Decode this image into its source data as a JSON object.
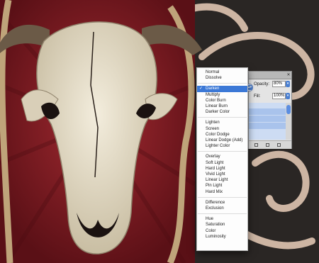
{
  "blend_menu": {
    "groups": [
      [
        "Normal",
        "Dissolve"
      ],
      [
        "Darken",
        "Multiply",
        "Color Burn",
        "Linear Burn",
        "Darker Color"
      ],
      [
        "Lighten",
        "Screen",
        "Color Dodge",
        "Linear Dodge (Add)",
        "Lighter Color"
      ],
      [
        "Overlay",
        "Soft Light",
        "Hard Light",
        "Vivid Light",
        "Linear Light",
        "Pin Light",
        "Hard Mix"
      ],
      [
        "Difference",
        "Exclusion"
      ],
      [
        "Hue",
        "Saturation",
        "Color",
        "Luminosity"
      ]
    ],
    "selected": "Darken",
    "check_glyph": "✓"
  },
  "layers_panel": {
    "opacity_label": "Opacity:",
    "opacity_value": "80%",
    "fill_label": "Fill:",
    "fill_value": "100%",
    "close_glyph": "✕"
  },
  "colors": {
    "menu_highlight": "#3b78d6",
    "red_backdrop": "#8c1f27",
    "bone": "#e9e2cf",
    "frame_gold": "#bfa47a",
    "background": "#2a2624"
  },
  "icons": [
    "checkmark-icon",
    "panel-close-icon",
    "stepper-arrows-icon"
  ]
}
